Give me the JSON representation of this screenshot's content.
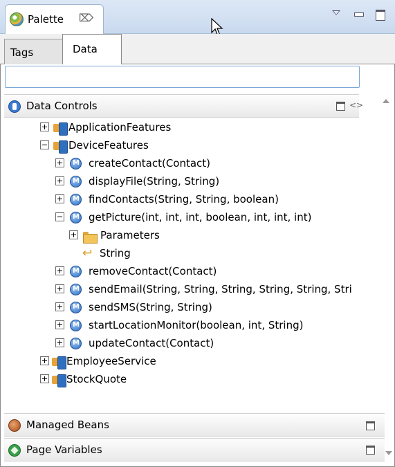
{
  "view": {
    "title": "Palette",
    "close_glyph": "⌦",
    "icons": [
      "palette-icon",
      "view-menu-icon",
      "minimize-icon",
      "maximize-icon"
    ]
  },
  "palette_tabs": [
    {
      "label": "Tags",
      "selected": false
    },
    {
      "label": "Data",
      "selected": true
    }
  ],
  "search": {
    "value": "",
    "placeholder": ""
  },
  "sections": {
    "data_controls": {
      "label": "Data Controls",
      "icon": "data-controls-icon"
    },
    "managed_beans": {
      "label": "Managed Beans",
      "icon": "managed-beans-icon"
    },
    "page_variables": {
      "label": "Page Variables",
      "icon": "page-variables-icon"
    }
  },
  "tree": {
    "application_features": "ApplicationFeatures",
    "device_features": "DeviceFeatures",
    "methods": [
      "createContact(Contact)",
      "displayFile(String, String)",
      "findContacts(String, String, boolean)",
      "getPicture(int, int, int, boolean, int, int, int)"
    ],
    "parameters": "Parameters",
    "return_type": "String",
    "methods_after": [
      "removeContact(Contact)",
      "sendEmail(String, String, String, String, String, Stri",
      "sendSMS(String, String)",
      "startLocationMonitor(boolean, int, String)",
      "updateContact(Contact)"
    ],
    "employee_service": "EmployeeService",
    "stock_quote": "StockQuote"
  },
  "colors": {
    "header_gradient_top": "#dde8f6",
    "method_icon": "#2d6fc6",
    "search_border": "#7aa9d9"
  }
}
